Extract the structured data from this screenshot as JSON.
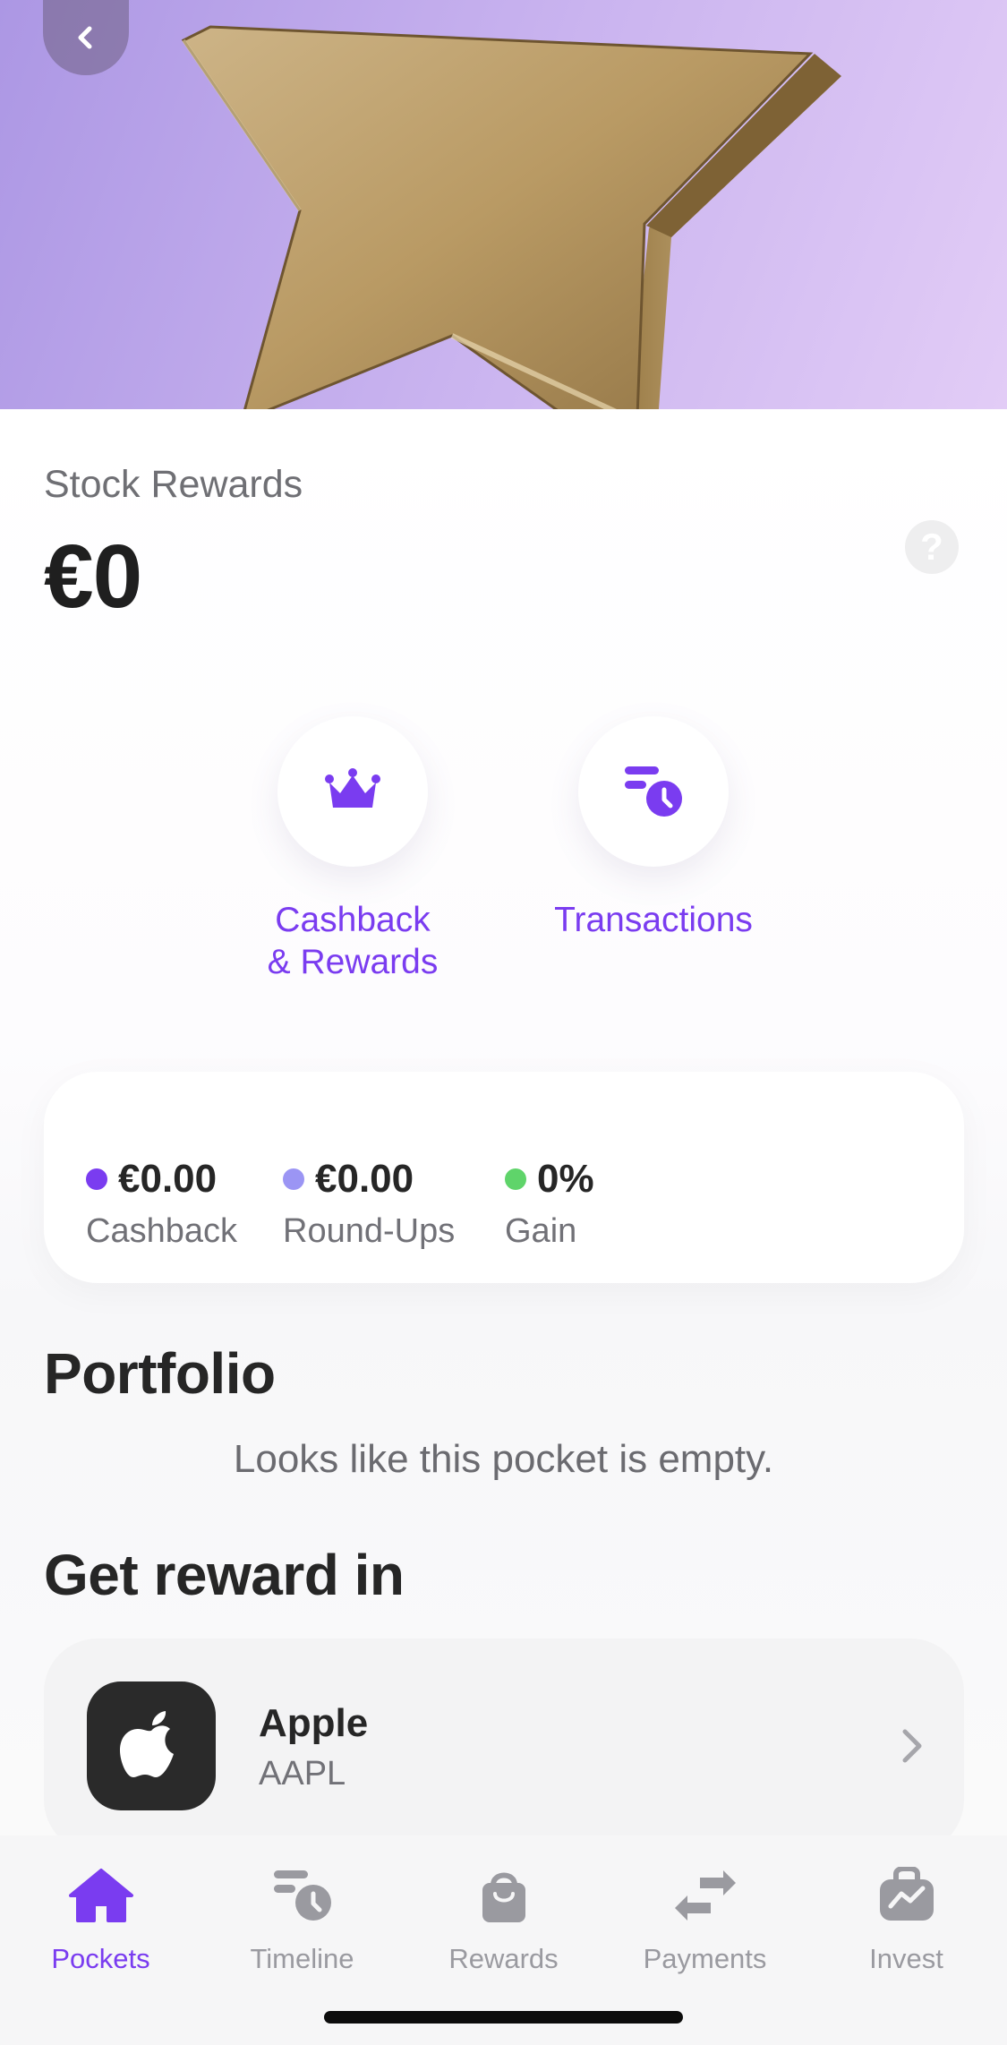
{
  "header": {
    "back_icon": "chevron-left-icon",
    "hero_image": "gold-star"
  },
  "balance": {
    "label": "Stock Rewards",
    "amount": "€0",
    "help_symbol": "?"
  },
  "actions": [
    {
      "label": "Cashback\n& Rewards",
      "icon": "crown-icon"
    },
    {
      "label": "Transactions",
      "icon": "list-clock-icon"
    }
  ],
  "stats": [
    {
      "value": "€0.00",
      "label": "Cashback",
      "color": "#7a3cf0"
    },
    {
      "value": "€0.00",
      "label": "Round-Ups",
      "color": "#9b95f4"
    },
    {
      "value": "0%",
      "label": "Gain",
      "color": "#5fd46a"
    }
  ],
  "portfolio": {
    "title": "Portfolio",
    "empty_text": "Looks like this pocket is empty."
  },
  "rewards_section": {
    "title": "Get reward in",
    "items": [
      {
        "name": "Apple",
        "ticker": "AAPL",
        "icon": "apple-logo-icon"
      }
    ]
  },
  "tabbar": {
    "tabs": [
      {
        "label": "Pockets",
        "icon": "home-icon",
        "active": true
      },
      {
        "label": "Timeline",
        "icon": "timeline-icon",
        "active": false
      },
      {
        "label": "Rewards",
        "icon": "shopping-bag-icon",
        "active": false
      },
      {
        "label": "Payments",
        "icon": "transfer-arrows-icon",
        "active": false
      },
      {
        "label": "Invest",
        "icon": "briefcase-chart-icon",
        "active": false
      }
    ]
  },
  "colors": {
    "accent": "#7a3cf0",
    "inactive": "#9a9aa0"
  }
}
